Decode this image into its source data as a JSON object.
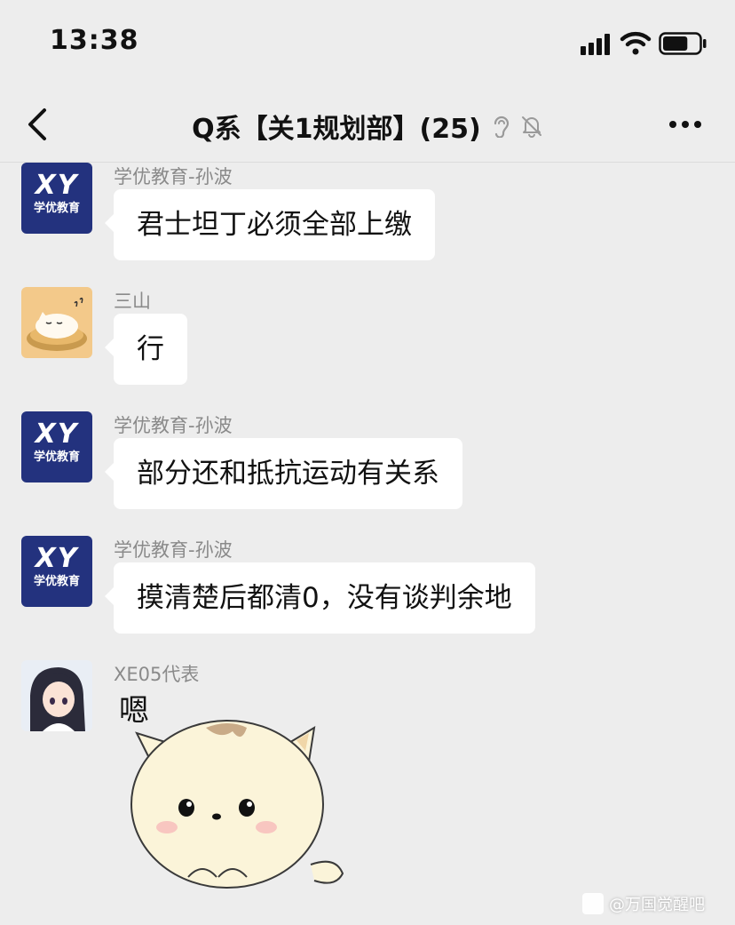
{
  "status_bar": {
    "time": "13:38",
    "battery_level": 0.7
  },
  "header": {
    "title": "Q系【关1规划部】(25)"
  },
  "messages": [
    {
      "sender": "学优教育-孙波",
      "text": "君士坦丁必须全部上缴"
    },
    {
      "sender": "三山",
      "text": "行"
    },
    {
      "sender": "学优教育-孙波",
      "text": "部分还和抵抗运动有关系"
    },
    {
      "sender": "学优教育-孙波",
      "text": "摸清楚后都清0，没有谈判余地"
    },
    {
      "sender": "XE05代表",
      "sticker_text": "嗯"
    }
  ],
  "avatars": {
    "xy_logo": "XY",
    "xy_sub": "学优教育"
  },
  "watermark": "@万国觉醒吧",
  "colors": {
    "background": "#ededed",
    "bubble": "#ffffff",
    "xy_avatar": "#23327e"
  }
}
